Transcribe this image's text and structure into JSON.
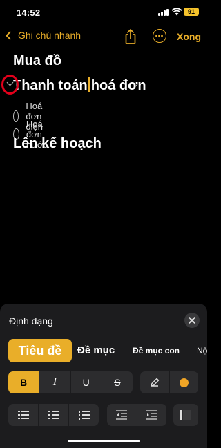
{
  "status": {
    "time": "14:52",
    "battery": "91"
  },
  "nav": {
    "back_label": "Ghi chú nhanh",
    "done_label": "Xong"
  },
  "note": {
    "heading1": "Mua đồ",
    "heading2_before": "Thanh toán",
    "heading2_after": "hoá đơn",
    "checklist": [
      "Hoá đơn điện",
      "Hoá đơn nước"
    ],
    "heading3": "Lên kế hoạch"
  },
  "format_panel": {
    "title": "Định dạng",
    "styles": [
      "Tiêu đề",
      "Đề mục",
      "Đề mục con",
      "Nộ"
    ],
    "selected_style": "Tiêu đề",
    "text_buttons": [
      "B",
      "I",
      "U",
      "S"
    ],
    "accent_color": "#e9ae29",
    "highlight_color": "#f0a526"
  }
}
